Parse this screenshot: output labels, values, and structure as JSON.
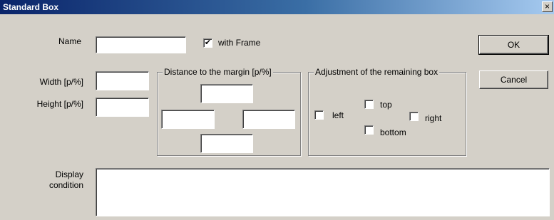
{
  "window": {
    "title": "Standard Box",
    "close_glyph": "×"
  },
  "fields": {
    "name_label": "Name",
    "name_value": "",
    "with_frame_label": "with Frame",
    "with_frame_checked": true,
    "width_label": "Width [p/%]",
    "width_value": "",
    "height_label": "Height [p/%]",
    "height_value": "",
    "display_condition_label_line1": "Display",
    "display_condition_label_line2": "condition",
    "display_condition_value": ""
  },
  "margin_group": {
    "legend": "Distance to the margin [p/%]",
    "top_value": "",
    "left_value": "",
    "right_value": "",
    "bottom_value": ""
  },
  "adjustment_group": {
    "legend": "Adjustment of the remaining box",
    "left_label": "left",
    "top_label": "top",
    "right_label": "right",
    "bottom_label": "bottom",
    "left_checked": false,
    "top_checked": false,
    "right_checked": false,
    "bottom_checked": false
  },
  "buttons": {
    "ok": "OK",
    "cancel": "Cancel"
  },
  "glyphs": {
    "checkmark": "✔"
  }
}
